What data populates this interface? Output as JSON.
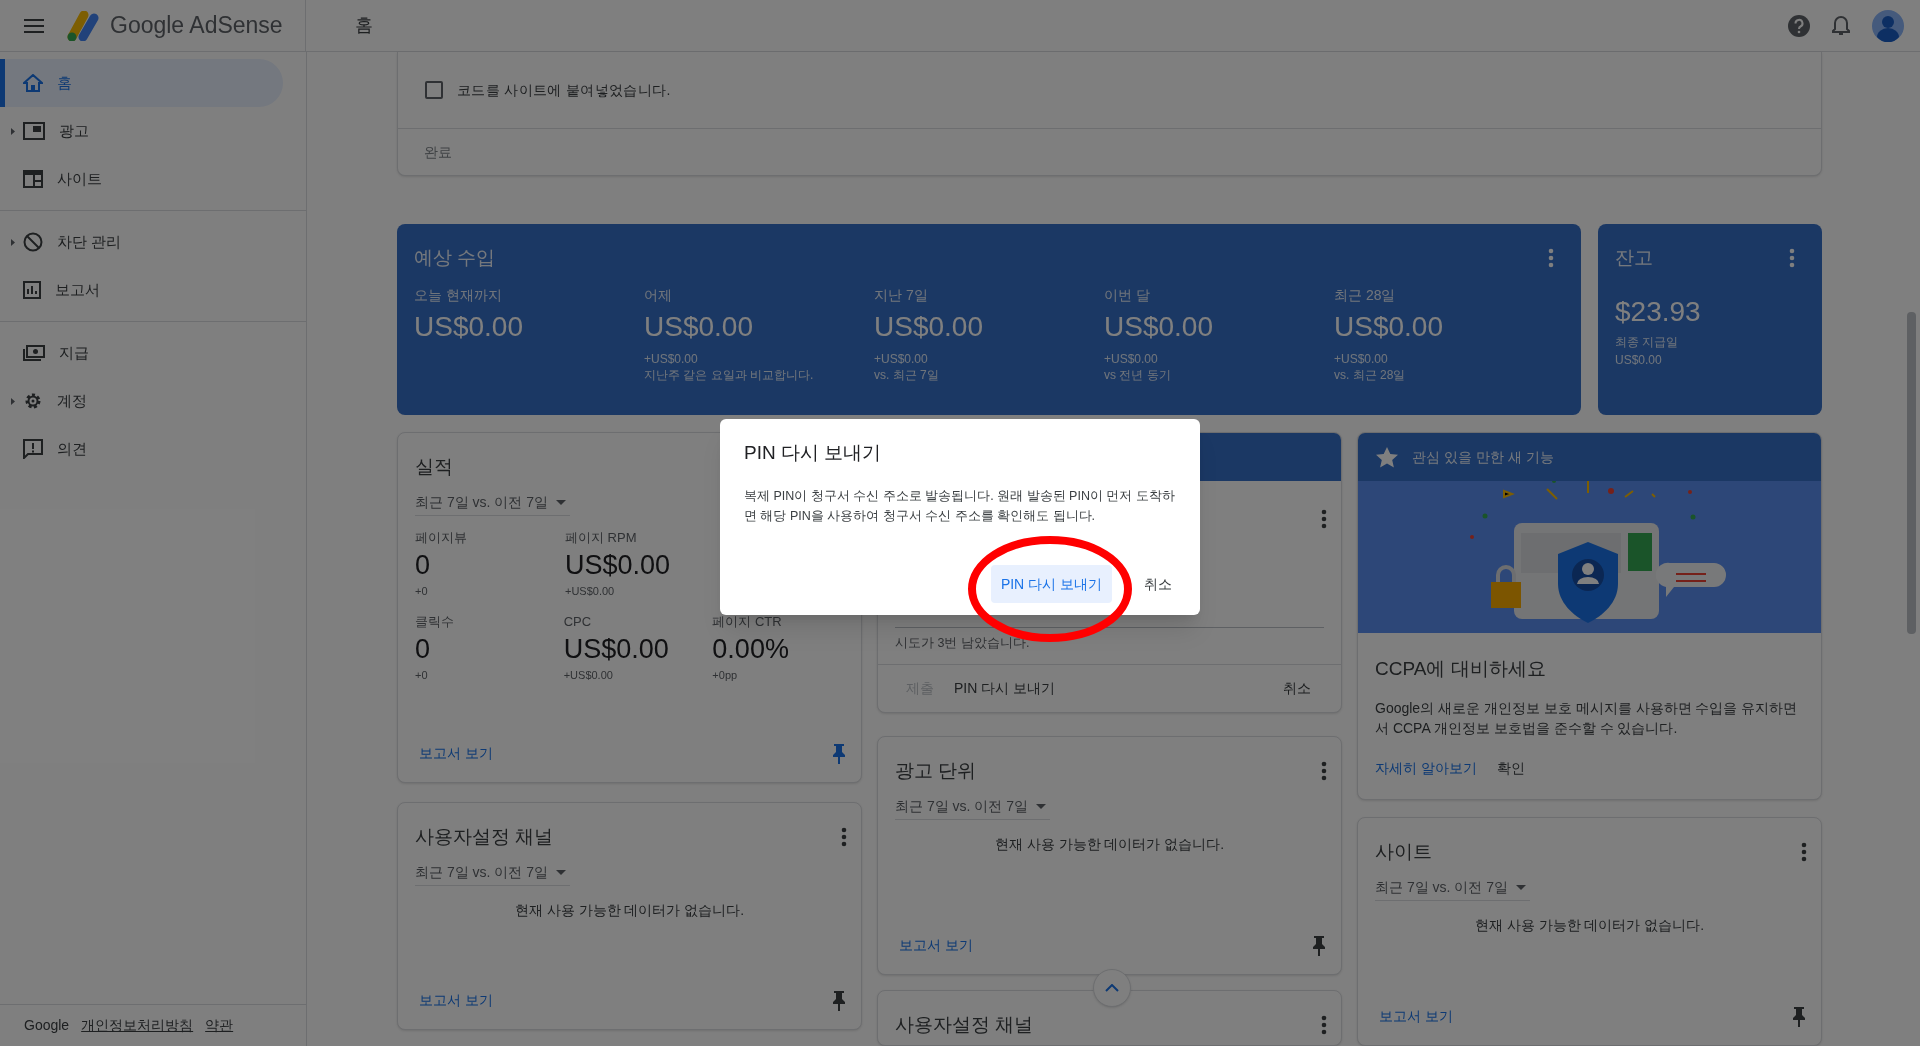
{
  "header": {
    "app_name": "Google AdSense",
    "page_title": "홈"
  },
  "sidebar": {
    "groups": [
      [
        {
          "label": "홈",
          "selected": true,
          "expandable": false
        },
        {
          "label": "광고",
          "selected": false,
          "expandable": true
        },
        {
          "label": "사이트",
          "selected": false,
          "expandable": false
        }
      ],
      [
        {
          "label": "차단 관리",
          "selected": false,
          "expandable": true
        },
        {
          "label": "보고서",
          "selected": false,
          "expandable": false
        }
      ],
      [
        {
          "label": "지급",
          "selected": false,
          "expandable": false
        },
        {
          "label": "계정",
          "selected": false,
          "expandable": true
        },
        {
          "label": "의견",
          "selected": false,
          "expandable": false
        }
      ]
    ],
    "footer": {
      "brand": "Google",
      "links": [
        "개인정보처리방침",
        "약관"
      ]
    }
  },
  "setup_card": {
    "checkbox": {
      "label": "코드를 사이트에 붙여넣었습니다.",
      "checked": false
    },
    "done_button": {
      "label": "완료",
      "disabled": true
    }
  },
  "revenue": {
    "title": "예상 수입",
    "metrics": [
      {
        "label": "오늘 현재까지",
        "value": "US$0.00"
      },
      {
        "label": "어제",
        "value": "US$0.00",
        "delta": "+US$0.00",
        "comparison": "지난주 같은 요일과 비교합니다."
      },
      {
        "label": "지난 7일",
        "value": "US$0.00",
        "delta": "+US$0.00",
        "comparison": "vs. 최근 7일"
      },
      {
        "label": "이번 달",
        "value": "US$0.00",
        "delta": "+US$0.00",
        "comparison": "vs 전년 동기"
      },
      {
        "label": "최근 28일",
        "value": "US$0.00",
        "delta": "+US$0.00",
        "comparison": "vs. 최근 28일"
      }
    ]
  },
  "balance": {
    "title": "잔고",
    "value": "$23.93",
    "label": "최종 지급일",
    "sub": "US$0.00"
  },
  "performance": {
    "title": "실적",
    "range": "최근 7일 vs. 이전 7일",
    "metric_rows": [
      [
        {
          "label": "페이지뷰",
          "value": "0",
          "delta": "+0"
        },
        {
          "label": "페이지 RPM",
          "value": "US$0.00",
          "delta": "+US$0.00"
        }
      ],
      [
        {
          "label": "클릭수",
          "value": "0",
          "delta": "+0"
        },
        {
          "label": "CPC",
          "value": "US$0.00",
          "delta": "+US$0.00"
        },
        {
          "label": "페이지 CTR",
          "value": "0.00%",
          "delta": "+0pp"
        }
      ]
    ],
    "report_link": "보고서 보기",
    "pinned": true
  },
  "custom_channels": {
    "title": "사용자설정 채널",
    "range": "최근 7일 vs. 이전 7일",
    "empty": "현재 사용 가능한 데이터가 없습니다.",
    "report_link": "보고서 보기",
    "pinned": false
  },
  "pin_card": {
    "attempts": "시도가 3번 남았습니다.",
    "actions": [
      {
        "label": "제출",
        "disabled": true
      },
      {
        "label": "PIN 다시 보내기",
        "disabled": false
      },
      {
        "label": "취소",
        "disabled": false
      }
    ]
  },
  "ad_units": {
    "title": "광고 단위",
    "range": "최근 7일 vs. 이전 7일",
    "empty": "현재 사용 가능한 데이터가 없습니다.",
    "report_link": "보고서 보기",
    "pinned": false
  },
  "custom_channels_2": {
    "title": "사용자설정 채널"
  },
  "new_feature": {
    "header": "관심 있을 만한 새 기능",
    "title": "CCPA에 대비하세요",
    "body": "Google의 새로운 개인정보 보호 메시지를 사용하면 수입을 유지하면서 CCPA 개인정보 보호법을 준수할 수 있습니다.",
    "actions": [
      {
        "label": "자세히 알아보기",
        "primary": true
      },
      {
        "label": "확인",
        "primary": false
      }
    ]
  },
  "sites": {
    "title": "사이트",
    "range": "최근 7일 vs. 이전 7일",
    "empty": "현재 사용 가능한 데이터가 없습니다.",
    "report_link": "보고서 보기",
    "pinned": false
  },
  "dialog": {
    "title": "PIN 다시 보내기",
    "body": "복제 PIN이 청구서 수신 주소로 발송됩니다. 원래 발송된 PIN이 먼저 도착하면 해당 PIN을 사용하여 청구서 수신 주소를 확인해도 됩니다.",
    "buttons": [
      {
        "label": "PIN 다시 보내기",
        "primary": true
      },
      {
        "label": "취소",
        "primary": false
      }
    ]
  },
  "annotation": {
    "kind": "ellipse",
    "color": "#ff0000"
  }
}
